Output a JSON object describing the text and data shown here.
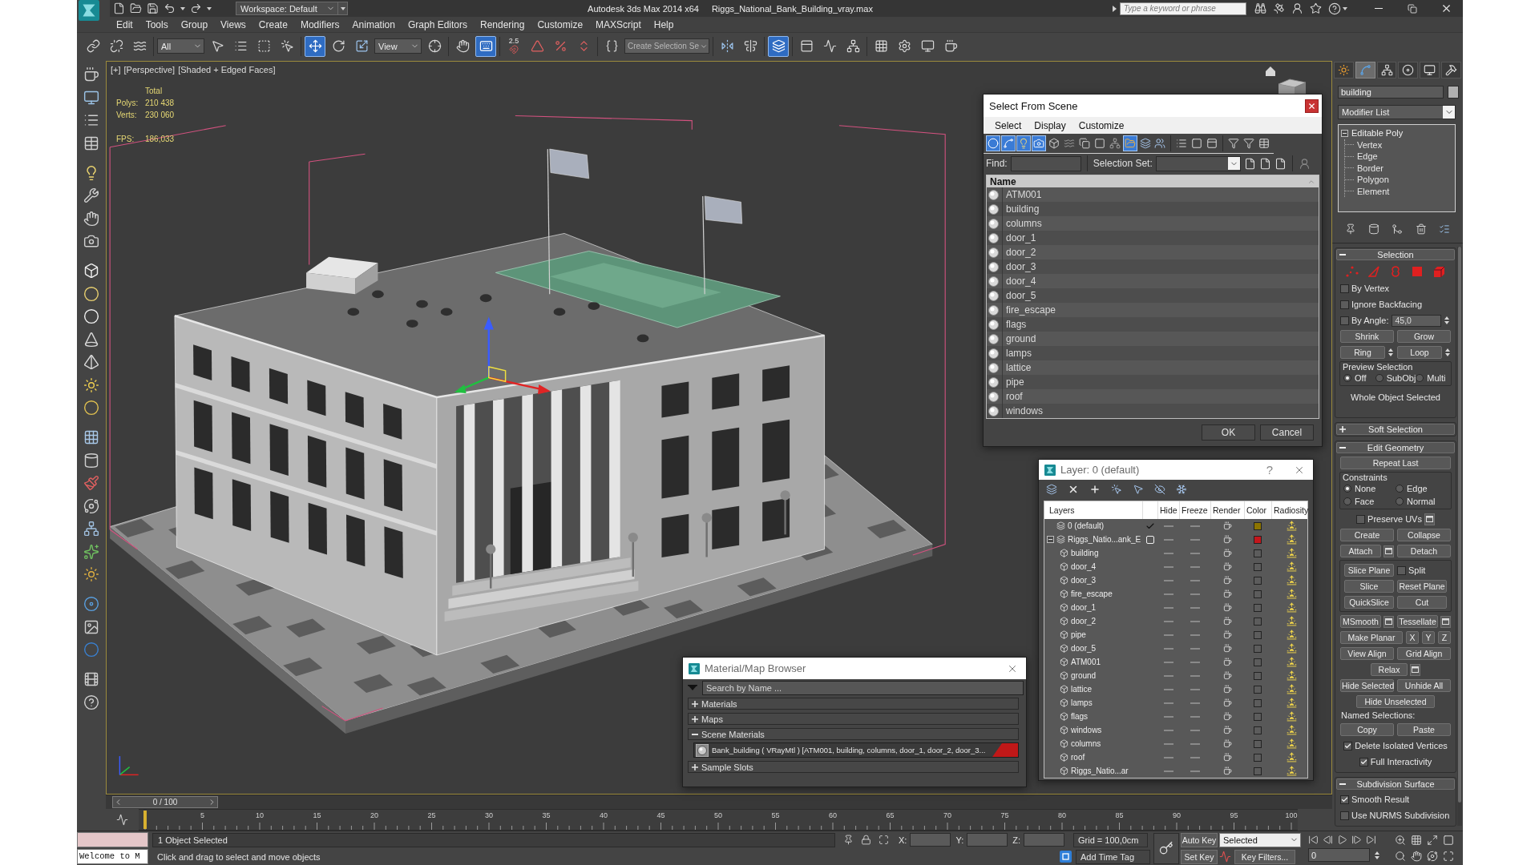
{
  "title_bar": {
    "workspace": "Workspace: Default",
    "app_name": "Autodesk 3ds Max 2014 x64",
    "file_name": "Riggs_National_Bank_Building_vray.max",
    "search": {
      "placeholder": "Type a keyword or phrase"
    }
  },
  "menu_bar": [
    "Edit",
    "Tools",
    "Group",
    "Views",
    "Create",
    "Modifiers",
    "Animation",
    "Graph Editors",
    "Rendering",
    "Customize",
    "MAXScript",
    "Help"
  ],
  "main_toolbar": [
    {
      "kind": "icon",
      "selected": false
    },
    {
      "kind": "icon",
      "selected": false
    },
    {
      "kind": "icon",
      "selected": false
    },
    {
      "kind": "dropdown",
      "value": "All"
    },
    {
      "kind": "icon",
      "selected": false
    },
    {
      "kind": "icon",
      "selected": false
    },
    {
      "kind": "icon",
      "selected": false
    },
    {
      "kind": "icon",
      "selected": false
    },
    {
      "kind": "icon",
      "selected": true
    },
    {
      "kind": "icon",
      "selected": false
    },
    {
      "kind": "icon",
      "selected": false
    },
    {
      "kind": "dropdown",
      "value": "View"
    },
    {
      "kind": "icon",
      "selected": false
    },
    {
      "kind": "icon",
      "selected": false
    },
    {
      "kind": "icon",
      "selected": true
    },
    {
      "kind": "snap",
      "label": "2.5",
      "selected": false
    },
    {
      "kind": "icon",
      "selected": false
    },
    {
      "kind": "icon",
      "selected": false
    },
    {
      "kind": "icon",
      "selected": false
    },
    {
      "kind": "icon",
      "selected": false
    },
    {
      "kind": "field",
      "placeholder": "Create Selection Se"
    },
    {
      "kind": "icon",
      "selected": false
    },
    {
      "kind": "icon",
      "selected": false
    },
    {
      "kind": "icon",
      "selected": true
    },
    {
      "kind": "icon",
      "selected": false
    },
    {
      "kind": "icon",
      "selected": false
    },
    {
      "kind": "icon",
      "selected": false
    },
    {
      "kind": "icon",
      "selected": false
    },
    {
      "kind": "icon",
      "selected": false
    },
    {
      "kind": "icon",
      "selected": false
    },
    {
      "kind": "icon",
      "selected": false
    }
  ],
  "viewport": {
    "labels": [
      "[+]",
      "[Perspective]",
      "[Shaded + Edged Faces]"
    ],
    "stats_title": "Total",
    "stats": [
      {
        "label": "Polys:",
        "value": "210 438"
      },
      {
        "label": "Verts:",
        "value": "230 060"
      }
    ],
    "fps": {
      "label": "FPS:",
      "value": "186,033"
    }
  },
  "time_slider": {
    "label": "0 / 100",
    "level": 0
  },
  "track_bar": {
    "ticks": [
      "5",
      "10",
      "15",
      "20",
      "25",
      "30",
      "35",
      "40",
      "45",
      "50",
      "55",
      "60",
      "65",
      "70",
      "75",
      "80",
      "85",
      "90",
      "95",
      "100"
    ]
  },
  "command_panel": {
    "tabs": [
      {
        "selected": false
      },
      {
        "selected": true
      },
      {
        "selected": false
      },
      {
        "selected": false
      },
      {
        "selected": false
      },
      {
        "selected": false
      }
    ],
    "object_name": "building",
    "modifier_list": "Modifier List",
    "stack": [
      {
        "name": "Editable Poly",
        "selected": false,
        "expanded": true,
        "children": [
          {
            "name": "Vertex",
            "selected": false
          },
          {
            "name": "Edge",
            "selected": false
          },
          {
            "name": "Border",
            "selected": false
          },
          {
            "name": "Polygon",
            "selected": false
          },
          {
            "name": "Element",
            "selected": false
          }
        ]
      }
    ],
    "rollouts": [
      {
        "kind": "selection",
        "title": "Selection",
        "expanded": true,
        "rows": [
          {
            "kind": "subobjects",
            "items": [
              {
                "selected": false
              },
              {
                "selected": false
              },
              {
                "selected": false
              },
              {
                "selected": false
              },
              {
                "selected": false
              }
            ]
          },
          {
            "kind": "row",
            "items": [
              {
                "kind": "checkbox",
                "label": "By Vertex",
                "checked": false
              }
            ]
          },
          {
            "kind": "row",
            "items": [
              {
                "kind": "checkbox",
                "label": "Ignore Backfacing",
                "checked": false
              }
            ]
          },
          {
            "kind": "row",
            "items": [
              {
                "kind": "checkbox",
                "label": "By Angle:",
                "checked": false
              },
              {
                "kind": "spinner",
                "value": "45,0"
              }
            ]
          },
          {
            "kind": "row",
            "items": [
              {
                "kind": "button",
                "label": "Shrink"
              },
              {
                "kind": "button",
                "label": "Grow"
              }
            ]
          },
          {
            "kind": "row",
            "items": [
              {
                "kind": "button",
                "label": "Ring",
                "spinner": true
              },
              {
                "kind": "button",
                "label": "Loop",
                "spinner": true
              }
            ]
          },
          {
            "kind": "radios",
            "label": "Preview Selection",
            "options": [
              {
                "label": "Off",
                "selected": true
              },
              {
                "label": "SubObj",
                "selected": false
              },
              {
                "label": "Multi",
                "selected": false
              }
            ]
          },
          {
            "kind": "status",
            "text": "Whole Object Selected"
          }
        ]
      },
      {
        "kind": "soft_selection",
        "title": "Soft Selection",
        "expanded": false
      },
      {
        "kind": "edit_geometry",
        "title": "Edit Geometry",
        "expanded": true,
        "rows": [
          {
            "kind": "row",
            "items": [
              {
                "kind": "wide_button",
                "label": "Repeat Last"
              }
            ]
          },
          {
            "kind": "radios",
            "label": "Constraints",
            "options": [
              {
                "label": "None",
                "selected": true
              },
              {
                "label": "Edge",
                "selected": false
              },
              {
                "label": "Face",
                "selected": false
              },
              {
                "label": "Normal",
                "selected": false
              }
            ]
          },
          {
            "kind": "row",
            "items": [
              {
                "kind": "checkbox",
                "label": "Preserve UVs",
                "checked": false,
                "settings": true
              }
            ]
          },
          {
            "kind": "row",
            "items": [
              {
                "kind": "button",
                "label": "Create"
              },
              {
                "kind": "button",
                "label": "Collapse"
              }
            ]
          },
          {
            "kind": "row",
            "items": [
              {
                "kind": "button",
                "label": "Attach",
                "settings": true
              },
              {
                "kind": "button",
                "label": "Detach"
              }
            ]
          },
          {
            "kind": "group",
            "rows": [
              {
                "kind": "row",
                "items": [
                  {
                    "kind": "button",
                    "label": "Slice Plane"
                  },
                  {
                    "kind": "checkbox",
                    "label": "Split",
                    "checked": false
                  }
                ]
              },
              {
                "kind": "row",
                "items": [
                  {
                    "kind": "button",
                    "label": "Slice"
                  },
                  {
                    "kind": "button",
                    "label": "Reset Plane"
                  }
                ]
              },
              {
                "kind": "row",
                "items": [
                  {
                    "kind": "button",
                    "label": "QuickSlice"
                  },
                  {
                    "kind": "button",
                    "label": "Cut"
                  }
                ]
              }
            ]
          },
          {
            "kind": "row",
            "items": [
              {
                "kind": "button",
                "label": "MSmooth",
                "settings": true
              },
              {
                "kind": "button",
                "label": "Tessellate",
                "settings": true
              }
            ]
          },
          {
            "kind": "row",
            "items": [
              {
                "kind": "button",
                "label": "Make Planar"
              },
              {
                "kind": "axis",
                "label": "X"
              },
              {
                "kind": "axis",
                "label": "Y"
              },
              {
                "kind": "axis",
                "label": "Z"
              }
            ]
          },
          {
            "kind": "row",
            "items": [
              {
                "kind": "button",
                "label": "View Align"
              },
              {
                "kind": "button",
                "label": "Grid Align"
              }
            ]
          },
          {
            "kind": "row",
            "items": [
              {
                "kind": "button",
                "label": "Relax",
                "settings": true
              }
            ]
          },
          {
            "kind": "row",
            "items": [
              {
                "kind": "button",
                "label": "Hide Selected"
              },
              {
                "kind": "button",
                "label": "Unhide All"
              }
            ]
          },
          {
            "kind": "row",
            "items": [
              {
                "kind": "button",
                "label": "Hide Unselected"
              }
            ]
          },
          {
            "kind": "label",
            "text": "Named Selections:"
          },
          {
            "kind": "row",
            "items": [
              {
                "kind": "button",
                "label": "Copy"
              },
              {
                "kind": "button",
                "label": "Paste"
              }
            ]
          },
          {
            "kind": "row",
            "items": [
              {
                "kind": "checkbox",
                "label": "Delete Isolated Vertices",
                "checked": true
              }
            ]
          },
          {
            "kind": "row",
            "items": [
              {
                "kind": "checkbox",
                "label": "Full Interactivity",
                "checked": true
              }
            ]
          }
        ]
      },
      {
        "kind": "subdivision",
        "title": "Subdivision Surface",
        "expanded": true,
        "rows": [
          {
            "kind": "row",
            "items": [
              {
                "kind": "checkbox",
                "label": "Smooth Result",
                "checked": true
              }
            ]
          },
          {
            "kind": "row",
            "items": [
              {
                "kind": "checkbox",
                "label": "Use NURMS Subdivision",
                "checked": false
              }
            ]
          }
        ]
      }
    ]
  },
  "status_bar": {
    "listener": {
      "output": "Welcome to M"
    },
    "selection": "1 Object Selected",
    "prompt": "Click and drag to select and move objects",
    "coordinates": [
      {
        "label": "X:"
      },
      {
        "label": "Y:"
      },
      {
        "label": "Z:"
      }
    ],
    "grid": "Grid = 100,0cm",
    "time_tag": "Add Time Tag",
    "auto_key": {
      "label": "Auto Key",
      "on": false
    },
    "set_key": "Set Key",
    "key_mode": "Selected",
    "key_filters": "Key Filters...",
    "frame": "0"
  },
  "select_from_scene": {
    "title": "Select From Scene",
    "menus": [
      "Select",
      "Display",
      "Customize"
    ],
    "filters": [
      {
        "selected": true
      },
      {
        "selected": true
      },
      {
        "selected": true
      },
      {
        "selected": true
      },
      {
        "selected": false
      },
      {
        "selected": false
      },
      {
        "selected": false
      },
      {
        "selected": false
      },
      {
        "selected": false
      },
      {
        "selected": true
      },
      {
        "selected": false
      },
      {
        "selected": false
      }
    ],
    "find": {
      "label": "Find:"
    },
    "selection_set": {
      "label": "Selection Set:"
    },
    "column": "Name",
    "objects": [
      {
        "name": "ATM001",
        "selected": false
      },
      {
        "name": "building",
        "selected": false
      },
      {
        "name": "columns",
        "selected": false
      },
      {
        "name": "door_1",
        "selected": false
      },
      {
        "name": "door_2",
        "selected": false
      },
      {
        "name": "door_3",
        "selected": false
      },
      {
        "name": "door_4",
        "selected": false
      },
      {
        "name": "door_5",
        "selected": false
      },
      {
        "name": "fire_escape",
        "selected": false
      },
      {
        "name": "flags",
        "selected": false
      },
      {
        "name": "ground",
        "selected": false
      },
      {
        "name": "lamps",
        "selected": false
      },
      {
        "name": "lattice",
        "selected": false
      },
      {
        "name": "pipe",
        "selected": false
      },
      {
        "name": "roof",
        "selected": false
      },
      {
        "name": "windows",
        "selected": false
      }
    ],
    "buttons": [
      "OK",
      "Cancel"
    ]
  },
  "layer_dialog": {
    "title": "Layer: 0 (default)",
    "help": "?",
    "columns": [
      "Layers",
      "Hide",
      "Freeze",
      "Render",
      "Color",
      "Radiosity"
    ],
    "layers": [
      {
        "name": "0 (default)",
        "current": true,
        "selected": false,
        "hidden": false,
        "frozen": false,
        "renderable": true,
        "radiosity": true,
        "color": "#8c7400"
      },
      {
        "name": "Riggs_Natio...ank_E",
        "current": false,
        "selected": false,
        "expanded": true,
        "hidden": false,
        "frozen": false,
        "renderable": true,
        "radiosity": true,
        "color": "#c4161c",
        "children": [
          {
            "name": "building",
            "selected": false,
            "hidden": false,
            "frozen": false,
            "renderable": true,
            "radiosity": true,
            "color": "#5c5c5c"
          },
          {
            "name": "door_4",
            "selected": false,
            "hidden": false,
            "frozen": false,
            "renderable": true,
            "radiosity": true,
            "color": "#5c5c5c"
          },
          {
            "name": "door_3",
            "selected": false,
            "hidden": false,
            "frozen": false,
            "renderable": true,
            "radiosity": true,
            "color": "#5c5c5c"
          },
          {
            "name": "fire_escape",
            "selected": false,
            "hidden": false,
            "frozen": false,
            "renderable": true,
            "radiosity": true,
            "color": "#5c5c5c"
          },
          {
            "name": "door_1",
            "selected": false,
            "hidden": false,
            "frozen": false,
            "renderable": true,
            "radiosity": true,
            "color": "#5c5c5c"
          },
          {
            "name": "door_2",
            "selected": false,
            "hidden": false,
            "frozen": false,
            "renderable": true,
            "radiosity": true,
            "color": "#5c5c5c"
          },
          {
            "name": "pipe",
            "selected": false,
            "hidden": false,
            "frozen": false,
            "renderable": true,
            "radiosity": true,
            "color": "#5c5c5c"
          },
          {
            "name": "door_5",
            "selected": false,
            "hidden": false,
            "frozen": false,
            "renderable": true,
            "radiosity": true,
            "color": "#5c5c5c"
          },
          {
            "name": "ATM001",
            "selected": false,
            "hidden": false,
            "frozen": false,
            "renderable": true,
            "radiosity": true,
            "color": "#5c5c5c"
          },
          {
            "name": "ground",
            "selected": false,
            "hidden": false,
            "frozen": false,
            "renderable": true,
            "radiosity": true,
            "color": "#5c5c5c"
          },
          {
            "name": "lattice",
            "selected": false,
            "hidden": false,
            "frozen": false,
            "renderable": true,
            "radiosity": true,
            "color": "#5c5c5c"
          },
          {
            "name": "lamps",
            "selected": false,
            "hidden": false,
            "frozen": false,
            "renderable": true,
            "radiosity": true,
            "color": "#5c5c5c"
          },
          {
            "name": "flags",
            "selected": false,
            "hidden": false,
            "frozen": false,
            "renderable": true,
            "radiosity": true,
            "color": "#5c5c5c"
          },
          {
            "name": "windows",
            "selected": false,
            "hidden": false,
            "frozen": false,
            "renderable": true,
            "radiosity": true,
            "color": "#5c5c5c"
          },
          {
            "name": "columns",
            "selected": false,
            "hidden": false,
            "frozen": false,
            "renderable": true,
            "radiosity": true,
            "color": "#5c5c5c"
          },
          {
            "name": "roof",
            "selected": false,
            "hidden": false,
            "frozen": false,
            "renderable": true,
            "radiosity": true,
            "color": "#5c5c5c"
          },
          {
            "name": "Riggs_Natio...ar",
            "selected": false,
            "hidden": false,
            "frozen": false,
            "renderable": true,
            "radiosity": true,
            "color": "#5c5c5c"
          }
        ]
      }
    ]
  },
  "material_browser": {
    "title": "Material/Map Browser",
    "search": {
      "placeholder": "Search by Name ..."
    },
    "groups": [
      {
        "label": "Materials",
        "expanded": false
      },
      {
        "label": "Maps",
        "expanded": false
      },
      {
        "label": "Scene Materials",
        "expanded": true,
        "items": [
          {
            "label": "Bank_building ( VRayMtl ) [ATM001, building, columns, door_1, door_2, door_3...",
            "selected": false
          }
        ]
      },
      {
        "label": "Sample Slots",
        "expanded": false
      }
    ]
  }
}
